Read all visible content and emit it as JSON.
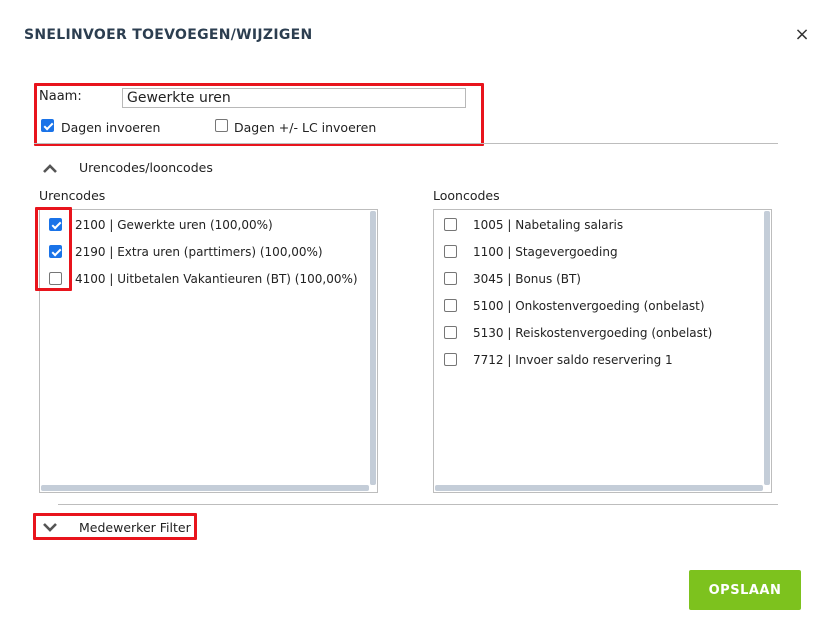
{
  "dialog": {
    "title": "SNELINVOER TOEVOEGEN/WIJZIGEN",
    "close_symbol": "×"
  },
  "naam": {
    "label": "Naam:",
    "value": "Gewerkte uren"
  },
  "options": {
    "dagen_invoeren": {
      "label": "Dagen invoeren",
      "checked": true
    },
    "dagen_lc_invoeren": {
      "label": "Dagen +/- LC invoeren",
      "checked": false
    }
  },
  "sections": {
    "codes": {
      "label": "Urencodes/looncodes",
      "icon": "chevron-up-icon",
      "expanded": true
    },
    "filter": {
      "label": "Medewerker Filter",
      "icon": "chevron-down-icon",
      "expanded": false
    }
  },
  "urencodes": {
    "heading": "Urencodes",
    "items": [
      {
        "label": "2100 | Gewerkte uren (100,00%)",
        "checked": true
      },
      {
        "label": "2190 | Extra uren (parttimers) (100,00%)",
        "checked": true
      },
      {
        "label": "4100 | Uitbetalen Vakantieuren (BT) (100,00%)",
        "checked": false
      }
    ]
  },
  "looncodes": {
    "heading": "Looncodes",
    "items": [
      {
        "label": "1005 | Nabetaling salaris",
        "checked": false
      },
      {
        "label": "1100 | Stagevergoeding",
        "checked": false
      },
      {
        "label": "3045 | Bonus (BT)",
        "checked": false
      },
      {
        "label": "5100 | Onkostenvergoeding (onbelast)",
        "checked": false
      },
      {
        "label": "5130 | Reiskostenvergoeding (onbelast)",
        "checked": false
      },
      {
        "label": "7712 | Invoer saldo reservering 1",
        "checked": false
      }
    ]
  },
  "actions": {
    "save_label": "OPSLAAN"
  },
  "colors": {
    "highlight": "#e8141c",
    "checkbox_checked": "#1a73e8",
    "save_button": "#7dc21e"
  }
}
